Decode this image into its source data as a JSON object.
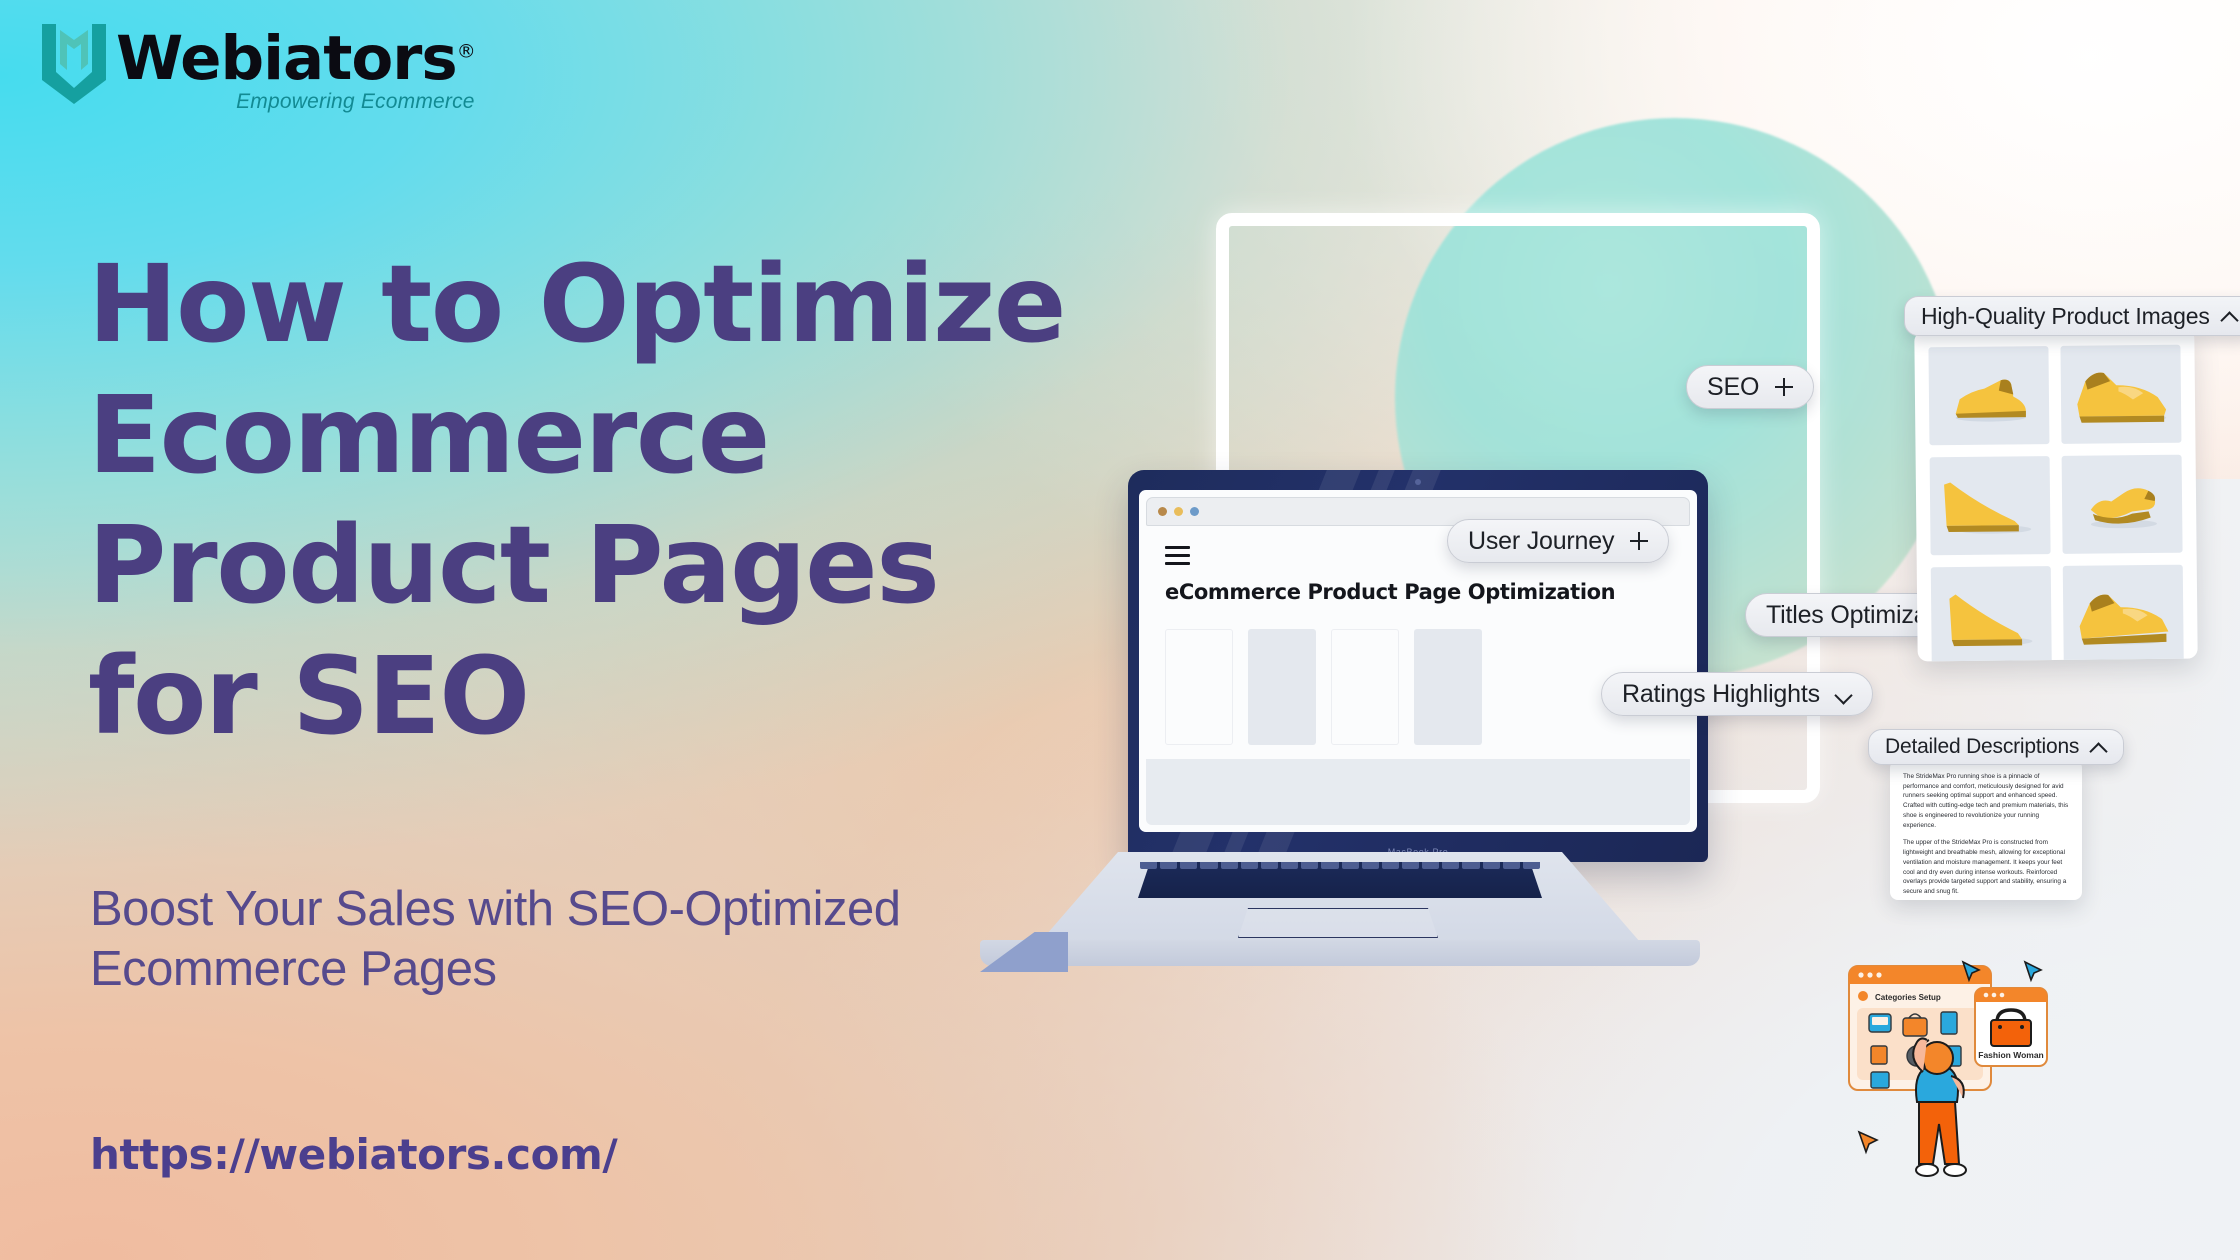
{
  "brand": {
    "name": "Webiators",
    "registered": "®",
    "tagline": "Empowering Ecommerce",
    "mark_icon": "webiators-shield-w-logo-icon",
    "mark_color": "#15a0a0"
  },
  "hero": {
    "headline": "How to Optimize Ecommerce Product Pages for SEO",
    "subheadline": "Boost Your Sales with SEO-Optimized Ecommerce Pages",
    "url": "https://webiators.com/",
    "headline_color": "#4b3f81",
    "subhead_color": "#564a8d",
    "url_color": "#4b3f8e"
  },
  "laptop": {
    "model_label": "MacBook Pro",
    "browser": {
      "dots": [
        "#b8894a",
        "#e9bd5b",
        "#6d9bc9"
      ],
      "menu_icon": "hamburger-menu-icon",
      "page_title": "eCommerce Product Page Optimization"
    }
  },
  "pills": [
    {
      "label": "SEO",
      "glyph": "plus-icon",
      "name": "pill-seo"
    },
    {
      "label": "User Journey",
      "glyph": "plus-icon",
      "name": "pill-user-journey"
    },
    {
      "label": "Ratings Highlights",
      "glyph": "chevron-down-icon",
      "name": "pill-ratings-highlights"
    },
    {
      "label": "Titles Optimization",
      "glyph": "chevron-down-icon",
      "name": "pill-titles-optimization"
    }
  ],
  "cards": {
    "product_images": {
      "title": "High-Quality Product Images",
      "glyph": "chevron-up-icon",
      "image_alt": "yellow-running-shoe-thumbnail",
      "tile_count": 6,
      "tile_bg": "#e3e8ef",
      "shoe_color": "#f5c33e"
    },
    "descriptions": {
      "title": "Detailed Descriptions",
      "glyph": "chevron-up-icon",
      "paragraphs": [
        "The StrideMax Pro running shoe is a pinnacle of performance and comfort, meticulously designed for avid runners seeking optimal support and enhanced speed. Crafted with cutting-edge tech and premium materials, this shoe is engineered to revolutionize your running experience.",
        "The upper of the StrideMax Pro is constructed from lightweight and breathable mesh, allowing for exceptional ventilation and moisture management. It keeps your feet cool and dry even during intense workouts. Reinforced overlays provide targeted support and stability, ensuring a secure and snug fit."
      ]
    }
  },
  "illustration": {
    "window_title": "Categories Setup",
    "product_card_label": "Fashion Woman",
    "cursor_icon": "cursor-arrow-icon",
    "accent_orange": "#f07818",
    "accent_blue": "#2aa8dd"
  },
  "palette": {
    "cyan": "#46dcee",
    "mint": "#a8e7dd",
    "peach": "#f0bca0",
    "navy": "#1e2c5c",
    "white": "#ffffff"
  }
}
